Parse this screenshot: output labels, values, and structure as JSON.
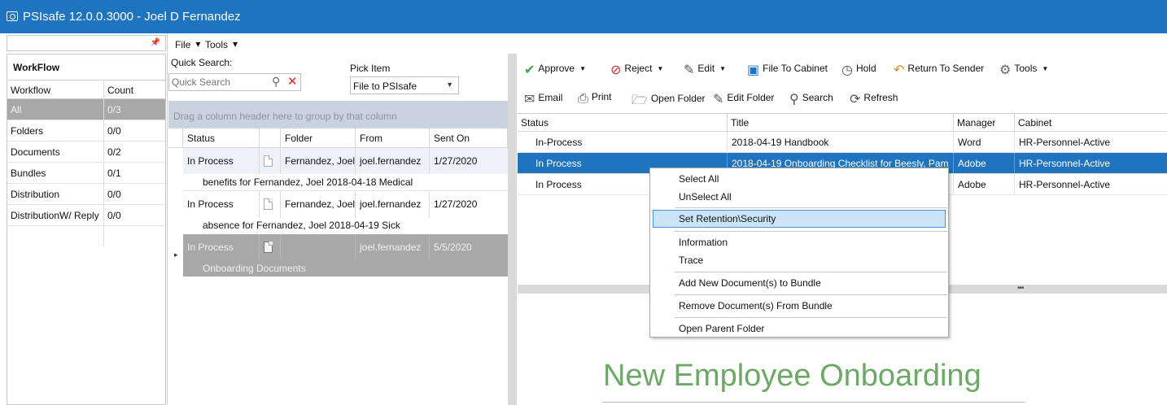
{
  "window": {
    "title": "PSIsafe 12.0.0.3000 - Joel D Fernandez"
  },
  "menubar": {
    "file": "File",
    "tools": "Tools"
  },
  "workflow_panel": {
    "title": "WorkFlow",
    "columns": {
      "workflow": "Workflow",
      "count": "Count"
    },
    "rows": [
      {
        "name": "All",
        "count": "0/3"
      },
      {
        "name": "Folders",
        "count": "0/0"
      },
      {
        "name": "Documents",
        "count": "0/2"
      },
      {
        "name": "Bundles",
        "count": "0/1"
      },
      {
        "name": "Distribution",
        "count": "0/0"
      },
      {
        "name": "DistributionW/ Reply",
        "count": "0/0"
      }
    ]
  },
  "quick_search": {
    "label": "Quick Search:",
    "placeholder": "Quick Search"
  },
  "pick_item": {
    "label": "Pick Item",
    "value": "File to PSIsafe"
  },
  "left_grid": {
    "group_hint": "Drag a column header here to group by that column",
    "columns": {
      "status": "Status",
      "folder": "Folder",
      "from": "From",
      "sent_on": "Sent On"
    },
    "rows": [
      {
        "status": "In Process",
        "folder": "Fernandez, Joel",
        "from": "joel.fernandez",
        "sent_on": "1/27/2020",
        "detail": "benefits for Fernandez, Joel 2018-04-18 Medical"
      },
      {
        "status": "In Process",
        "folder": "Fernandez, Joel",
        "from": "joel.fernandez",
        "sent_on": "1/27/2020",
        "detail": "absence for Fernandez, Joel 2018-04-19 Sick"
      },
      {
        "status": "In Process",
        "folder": "",
        "from": "joel.fernandez",
        "sent_on": "5/5/2020",
        "detail": "Onboarding Documents"
      }
    ]
  },
  "toolbar": {
    "approve": "Approve",
    "reject": "Reject",
    "edit": "Edit",
    "file_to_cabinet": "File To Cabinet",
    "hold": "Hold",
    "return_to_sender": "Return To Sender",
    "tools": "Tools",
    "email": "Email",
    "print": "Print",
    "open_folder": "Open Folder",
    "edit_folder": "Edit Folder",
    "search": "Search",
    "refresh": "Refresh"
  },
  "right_grid": {
    "columns": {
      "status": "Status",
      "title": "Title",
      "manager": "Manager",
      "cabinet": "Cabinet"
    },
    "rows": [
      {
        "status": "In-Process",
        "title": "2018-04-19 Handbook",
        "manager": "Word",
        "cabinet": "HR-Personnel-Active"
      },
      {
        "status": "In Process",
        "title": "2018-04-19 Onboarding Checklist for Beesly, Pam",
        "manager": "Adobe",
        "cabinet": "HR-Personnel-Active"
      },
      {
        "status": "In Process",
        "title": "",
        "manager": "Adobe",
        "cabinet": "HR-Personnel-Active"
      }
    ]
  },
  "context_menu": {
    "select_all": "Select All",
    "unselect_all": "UnSelect All",
    "set_retention": "Set Retention\\Security",
    "information": "Information",
    "trace": "Trace",
    "add_to_bundle": "Add New Document(s) to Bundle",
    "remove_from_bundle": "Remove Document(s) From Bundle",
    "open_parent": "Open Parent Folder"
  },
  "preview": {
    "heading": "New Employee Onboarding"
  },
  "colors": {
    "accent": "#1e74be",
    "selection_gray": "#a8a8a8",
    "preview_green": "#6aaa64"
  }
}
